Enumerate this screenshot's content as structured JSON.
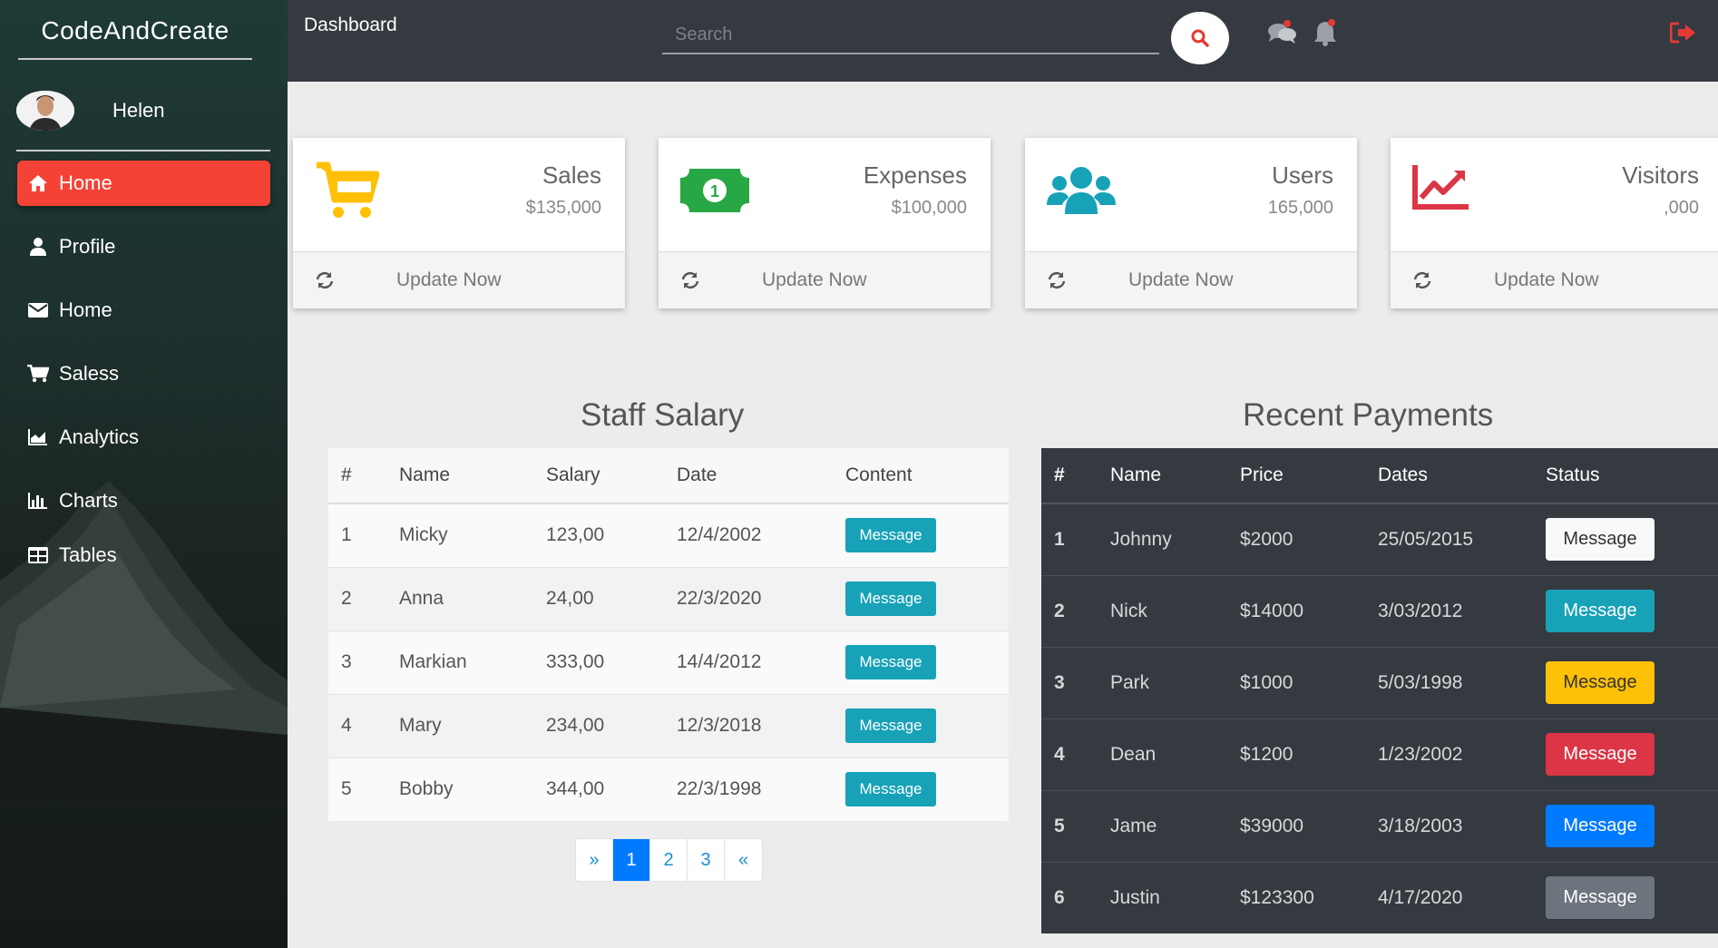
{
  "sidebar": {
    "brand": "CodeAndCreate",
    "user_name": "Helen",
    "items": [
      {
        "label": "Home",
        "icon": "home-icon",
        "active": true
      },
      {
        "label": "Profile",
        "icon": "user-icon"
      },
      {
        "label": "Home",
        "icon": "envelope-icon"
      },
      {
        "label": "Saless",
        "icon": "cart-icon"
      },
      {
        "label": "Analytics",
        "icon": "area-chart-icon"
      },
      {
        "label": "Charts",
        "icon": "bar-chart-icon"
      },
      {
        "label": "Tables",
        "icon": "table-icon"
      }
    ]
  },
  "header": {
    "title": "Dashboard",
    "search_placeholder": "Search"
  },
  "cards": [
    {
      "title": "Sales",
      "value": "$135,000",
      "action": "Update Now",
      "icon": "cart-icon",
      "color": "#ffc107"
    },
    {
      "title": "Expenses",
      "value": "$100,000",
      "action": "Update Now",
      "icon": "money-icon",
      "color": "#28a745"
    },
    {
      "title": "Users",
      "value": "165,000",
      "action": "Update Now",
      "icon": "users-icon",
      "color": "#17a2b8"
    },
    {
      "title": "Visitors",
      "value": ",000",
      "action": "Update Now",
      "icon": "line-chart-icon",
      "color": "#dc3545"
    }
  ],
  "staff": {
    "title": "Staff Salary",
    "headers": [
      "#",
      "Name",
      "Salary",
      "Date",
      "Content"
    ],
    "rows": [
      [
        "1",
        "Micky",
        "123,00",
        "12/4/2002",
        "Message"
      ],
      [
        "2",
        "Anna",
        "24,00",
        "22/3/2020",
        "Message"
      ],
      [
        "3",
        "Markian",
        "333,00",
        "14/4/2012",
        "Message"
      ],
      [
        "4",
        "Mary",
        "234,00",
        "12/3/2018",
        "Message"
      ],
      [
        "5",
        "Bobby",
        "344,00",
        "22/3/1998",
        "Message"
      ]
    ],
    "pagination": [
      "»",
      "1",
      "2",
      "3",
      "«"
    ]
  },
  "payments": {
    "title": "Recent Payments",
    "headers": [
      "#",
      "Name",
      "Price",
      "Dates",
      "Status"
    ],
    "rows": [
      [
        "1",
        "Johnny",
        "$2000",
        "25/05/2015",
        "Message"
      ],
      [
        "2",
        "Nick",
        "$14000",
        "3/03/2012",
        "Message"
      ],
      [
        "3",
        "Park",
        "$1000",
        "5/03/1998",
        "Message"
      ],
      [
        "4",
        "Dean",
        "$1200",
        "1/23/2002",
        "Message"
      ],
      [
        "5",
        "Jame",
        "$39000",
        "3/18/2003",
        "Message"
      ],
      [
        "6",
        "Justin",
        "$123300",
        "4/17/2020",
        "Message"
      ]
    ],
    "status_colors": [
      "#f8f9fa",
      "#17a2b8",
      "#ffc107",
      "#dc3545",
      "#007bff",
      "#6c757d"
    ],
    "status_text_colors": [
      "#333333",
      "#ffffff",
      "#333333",
      "#ffffff",
      "#ffffff",
      "#ffffff"
    ]
  }
}
